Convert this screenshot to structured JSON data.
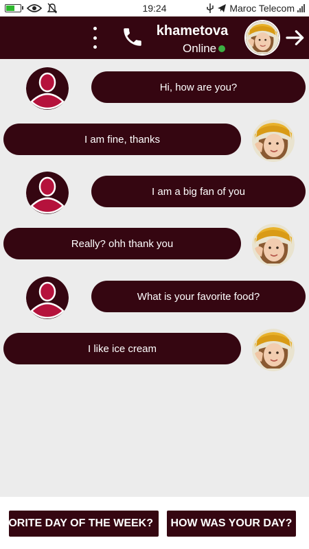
{
  "status_bar": {
    "time": "19:24",
    "carrier": "Maroc Telecom",
    "battery_level": 0.55,
    "icons": [
      "battery-icon",
      "eye-icon",
      "bell-off-icon",
      "usb-icon",
      "telegram-icon",
      "signal-icon"
    ]
  },
  "header": {
    "name": "khametova",
    "status": "Online",
    "status_color": "#3cb043",
    "icons": [
      "more-vertical-icon",
      "phone-icon",
      "avatar-photo",
      "arrow-right-icon"
    ]
  },
  "colors": {
    "header_bg": "#350611",
    "bubble_bg": "#350611",
    "chat_bg": "#ececec",
    "user_avatar_accent": "#b5123c"
  },
  "messages": [
    {
      "from": "user",
      "text": "Hi, how are you?"
    },
    {
      "from": "contact",
      "text": "I am fine, thanks"
    },
    {
      "from": "user",
      "text": "I am a big fan of you"
    },
    {
      "from": "contact",
      "text": "Really? ohh thank you"
    },
    {
      "from": "user",
      "text": "What is your favorite food?"
    },
    {
      "from": "contact",
      "text": "I like ice cream"
    }
  ],
  "suggestions": [
    {
      "label": "VORITE DAY OF THE WEEK?"
    },
    {
      "label": "HOW WAS YOUR DAY?"
    }
  ]
}
